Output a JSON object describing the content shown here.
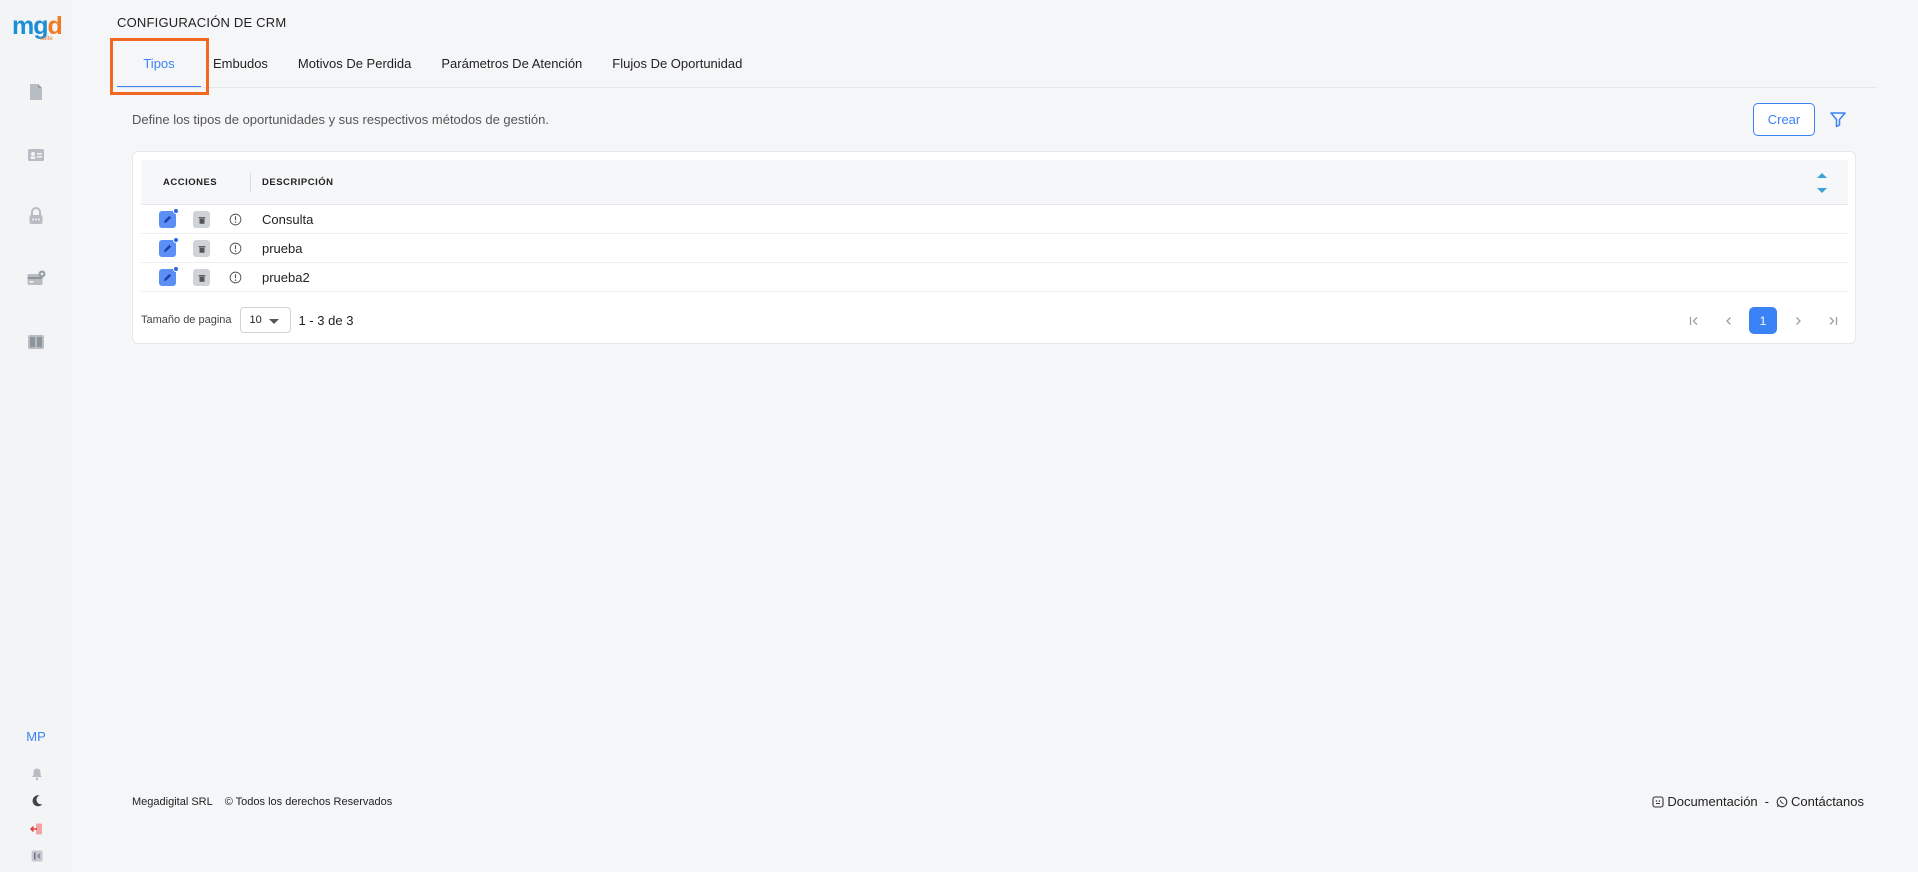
{
  "brand": {
    "logo_text_1": "mg",
    "logo_text_2": "d",
    "logo_suite": "suite"
  },
  "sidebar": {
    "items": [
      {
        "icon": "document-icon"
      },
      {
        "icon": "contact-card-icon"
      },
      {
        "icon": "lock-icon"
      },
      {
        "icon": "card-settings-icon"
      },
      {
        "icon": "book-icon"
      }
    ],
    "avatar": "MP",
    "bottom_icons": [
      "bell-icon",
      "moon-icon",
      "logout-icon",
      "collapse-icon"
    ]
  },
  "page": {
    "title": "CONFIGURACIÓN DE CRM",
    "tabs": [
      {
        "label": "Tipos",
        "active": true
      },
      {
        "label": "Embudos",
        "active": false
      },
      {
        "label": "Motivos De Perdida",
        "active": false
      },
      {
        "label": "Parámetros De Atención",
        "active": false
      },
      {
        "label": "Flujos De Oportunidad",
        "active": false
      }
    ],
    "description": "Define los tipos de oportunidades y sus respectivos métodos de gestión.",
    "create_label": "Crear"
  },
  "table": {
    "columns": [
      "ACCIONES",
      "DESCRIPCIÓN"
    ],
    "rows": [
      {
        "descripcion": "Consulta"
      },
      {
        "descripcion": "prueba"
      },
      {
        "descripcion": "prueba2"
      }
    ]
  },
  "pagination": {
    "page_size_label": "Tamaño de pagina",
    "page_size": "10",
    "range": "1 - 3 de 3",
    "current_page": "1"
  },
  "footer": {
    "company": "Megadigital SRL",
    "rights": "© Todos los derechos Reservados",
    "docs": "Documentación",
    "separator": "-",
    "contact": "Contáctanos"
  },
  "colors": {
    "accent": "#3b82f6",
    "highlight": "#f26722"
  }
}
